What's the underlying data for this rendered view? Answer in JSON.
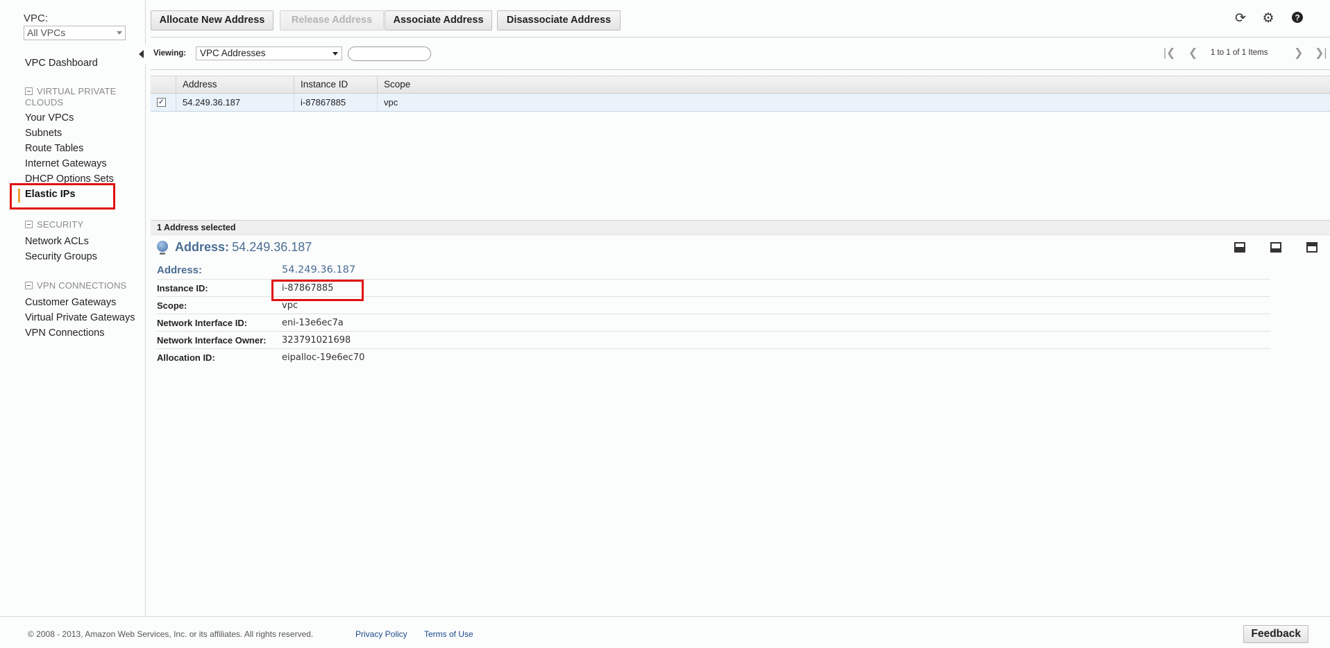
{
  "sidebar": {
    "vpc_label": "VPC:",
    "vpc_select_value": "All VPCs",
    "dashboard": "VPC Dashboard",
    "groups": [
      {
        "title": "VIRTUAL PRIVATE CLOUDS",
        "items": [
          "Your VPCs",
          "Subnets",
          "Route Tables",
          "Internet Gateways",
          "DHCP Options Sets",
          "Elastic IPs"
        ]
      },
      {
        "title": "SECURITY",
        "items": [
          "Network ACLs",
          "Security Groups"
        ]
      },
      {
        "title": "VPN CONNECTIONS",
        "items": [
          "Customer Gateways",
          "Virtual Private Gateways",
          "VPN Connections"
        ]
      }
    ],
    "active_item": "Elastic IPs",
    "icons": {
      "collapse": "collapse-sidebar-icon",
      "group_toggle": "minus-box-icon"
    }
  },
  "toolbar": {
    "allocate_label": "Allocate New Address",
    "release_label": "Release Address",
    "associate_label": "Associate Address",
    "disassociate_label": "Disassociate Address",
    "icons": [
      "refresh-icon",
      "gear-icon",
      "help-icon"
    ]
  },
  "viewing": {
    "label": "Viewing:",
    "select_value": "VPC Addresses",
    "search_value": "",
    "pager_text": "1 to 1 of 1 Items",
    "pager_icons": [
      "first-page-icon",
      "prev-page-icon",
      "next-page-icon",
      "last-page-icon"
    ]
  },
  "table": {
    "columns": [
      "Address",
      "Instance ID",
      "Scope"
    ],
    "rows": [
      {
        "checked": true,
        "address": "54.249.36.187",
        "instance_id": "i-87867885",
        "scope": "vpc"
      }
    ]
  },
  "detail": {
    "selection_text": "1 Address selected",
    "title_label": "Address:",
    "title_value": "54.249.36.187",
    "properties": [
      {
        "label": "Address:",
        "value": "54.249.36.187"
      },
      {
        "label": "Instance ID:",
        "value": "i-87867885"
      },
      {
        "label": "Scope:",
        "value": "vpc"
      },
      {
        "label": "Network Interface ID:",
        "value": "eni-13e6ec7a"
      },
      {
        "label": "Network Interface Owner:",
        "value": "323791021698"
      },
      {
        "label": "Allocation ID:",
        "value": "eipalloc-19e6ec70"
      }
    ],
    "pane_icons": [
      "pane-bottom-icon",
      "pane-half-icon",
      "pane-top-icon"
    ]
  },
  "footer": {
    "copyright": "© 2008 - 2013, Amazon Web Services, Inc. or its affiliates. All rights reserved.",
    "privacy": "Privacy Policy",
    "terms": "Terms of Use",
    "feedback": "Feedback"
  },
  "colors": {
    "accent": "#f0a030",
    "highlight": "#e01010",
    "link": "#1a4a8a",
    "title": "#4a6d93"
  }
}
